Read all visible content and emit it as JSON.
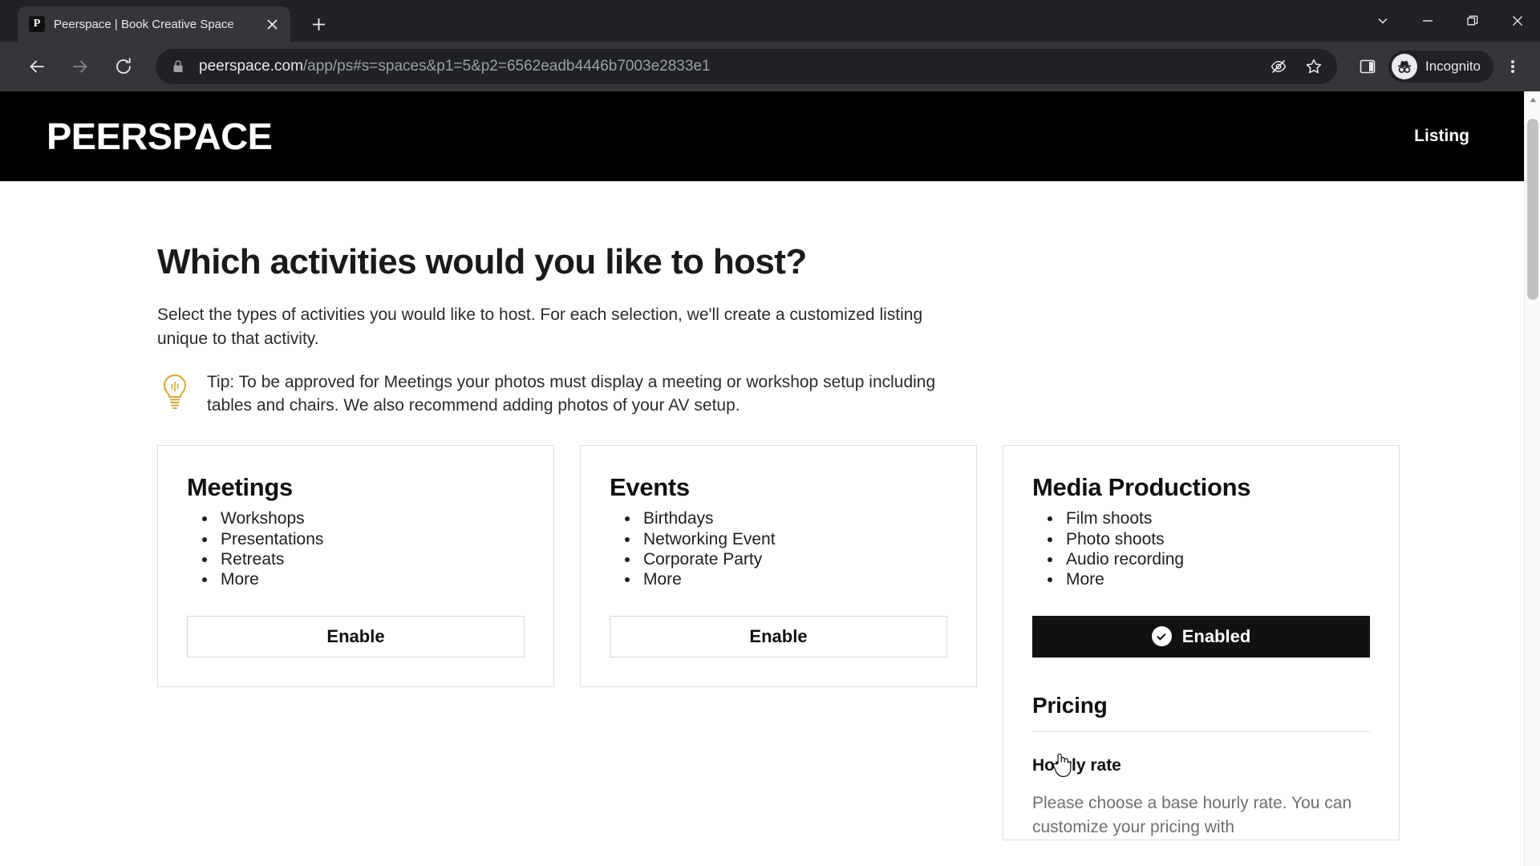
{
  "browser": {
    "tab": {
      "title": "Peerspace | Book Creative Space",
      "favicon_letter": "P",
      "close_label": "✕"
    },
    "new_tab_label": "+",
    "window_controls": [
      {
        "name": "tab-search",
        "label": "⌄"
      },
      {
        "name": "minimize",
        "label": "—"
      },
      {
        "name": "maximize",
        "label": "❐"
      },
      {
        "name": "close",
        "label": "✕"
      }
    ],
    "omnibox": {
      "domain": "peerspace.com",
      "path": "/app/ps#s=spaces&p1=5&p2=6562eadb4446b7003e2833e1",
      "full_url": "peerspace.com/app/ps#s=spaces&p1=5&p2=6562eadb4446b7003e2833e1"
    },
    "profile": {
      "label": "Incognito"
    },
    "colors": {
      "tabstrip_bg": "#202124",
      "toolbar_bg": "#35363a",
      "omnibox_bg": "#202124",
      "text": "#e8eaed",
      "muted_text": "#9aa0a6"
    }
  },
  "site": {
    "logo_text": "PEERSPACE",
    "nav": {
      "listing_label": "Listing"
    },
    "header_bg": "#000000"
  },
  "main": {
    "title": "Which activities would you like to host?",
    "description": "Select the types of activities you would like to host. For each selection, we'll create a customized listing unique to that activity.",
    "tip": "Tip: To be approved for Meetings your photos must display a meeting or workshop setup including tables and chairs. We also recommend adding photos of your AV setup.",
    "tip_icon_color": "#d4a93a",
    "cards": [
      {
        "title": "Meetings",
        "items": [
          "Workshops",
          "Presentations",
          "Retreats",
          "More"
        ],
        "button_label": "Enable",
        "enabled": false
      },
      {
        "title": "Events",
        "items": [
          "Birthdays",
          "Networking Event",
          "Corporate Party",
          "More"
        ],
        "button_label": "Enable",
        "enabled": false
      },
      {
        "title": "Media Productions",
        "items": [
          "Film shoots",
          "Photo shoots",
          "Audio recording",
          "More"
        ],
        "button_label": "Enabled",
        "enabled": true
      }
    ],
    "pricing": {
      "heading": "Pricing",
      "subheading": "Hourly rate",
      "description": "Please choose a base hourly rate. You can customize your pricing with"
    }
  }
}
